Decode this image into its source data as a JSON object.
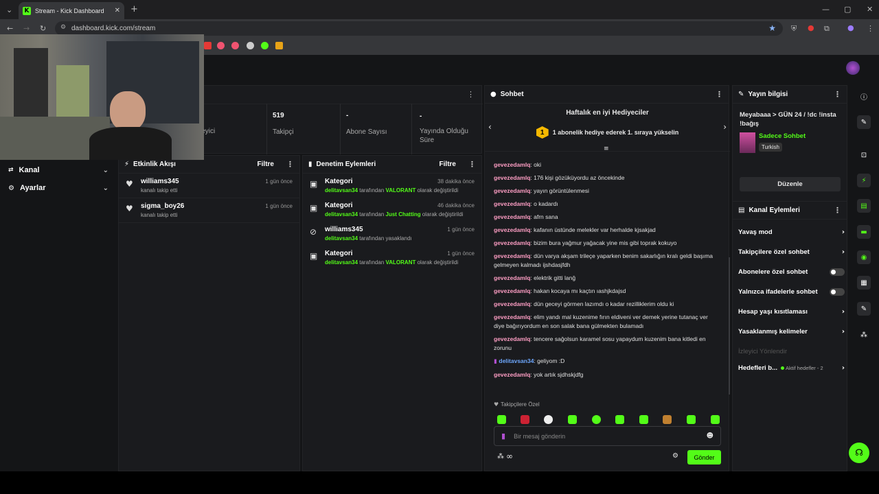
{
  "browser": {
    "tab_title": "Stream - Kick Dashboard",
    "url": "dashboard.kick.com/stream"
  },
  "nav": {
    "items": [
      {
        "label": "Kanal",
        "icon": "channel-icon"
      },
      {
        "label": "Ayarlar",
        "icon": "gear-icon"
      }
    ]
  },
  "stats": {
    "viewers_partial": "leyici",
    "followers_value": "519",
    "followers_label": "Takipçi",
    "subs_value": "-",
    "subs_label": "Abone Sayısı",
    "live_value": "-",
    "live_label": "Yayında Olduğu Süre"
  },
  "activity": {
    "title": "Etkinlik Akışı",
    "filter": "Filtre",
    "events": [
      {
        "user": "williams345",
        "text": "kanalı takip etti",
        "time": "1 gün önce"
      },
      {
        "user": "sigma_boy26",
        "text": "kanalı takip etti",
        "time": "1 gün önce"
      }
    ]
  },
  "moderation": {
    "title": "Denetim Eylemleri",
    "filter": "Filtre",
    "items": [
      {
        "title": "Kategori",
        "time": "38 dakika önce",
        "actor": "delitavsan34",
        "mid": " tarafından ",
        "hl": "VALORANT",
        "end": " olarak değiştirildi"
      },
      {
        "title": "Kategori",
        "time": "46 dakika önce",
        "actor": "delitavsan34",
        "mid": " tarafından ",
        "hl": "Just Chatting",
        "end": " olarak değiştirildi"
      },
      {
        "title": "williams345",
        "time": "1 gün önce",
        "actor": "delitavsan34",
        "mid": " tarafından yasaklandı",
        "hl": "",
        "end": ""
      },
      {
        "title": "Kategori",
        "time": "1 gün önce",
        "actor": "delitavsan34",
        "mid": " tarafından ",
        "hl": "VALORANT",
        "end": " olarak değiştirildi"
      }
    ]
  },
  "chat": {
    "title": "Sohbet",
    "gifters_title": "Haftalık en iyi Hediyeciler",
    "gifters_rank": "1",
    "gifters_text": "1 abonelik hediye ederek 1. sıraya yükselin",
    "messages": [
      {
        "user": "gevezedamlq",
        "text": "oki"
      },
      {
        "user": "gevezedamlq",
        "text": "176 kişi gözüküyordu az öncekinde"
      },
      {
        "user": "gevezedamlq",
        "text": "yayın görüntülenmesi"
      },
      {
        "user": "gevezedamlq",
        "text": "o kadardı"
      },
      {
        "user": "gevezedamlq",
        "text": "afrn sana"
      },
      {
        "user": "gevezedamlq",
        "text": "kafanın üstünde melekler var herhalde kjsakjad"
      },
      {
        "user": "gevezedamlq",
        "text": "bizim bura yağmur yağacak yine mis gibi toprak kokuyo"
      },
      {
        "user": "gevezedamlq",
        "text": "dün varya akşam trileçe yaparken benim sakarlığın kralı geldi başıma gelmeyen kalmadı ijshdasjfdh"
      },
      {
        "user": "gevezedamlq",
        "text": "elektrik gitti lanğ"
      },
      {
        "user": "gevezedamlq",
        "text": "hakan kocaya mı kaçtın ıashjkdajsd"
      },
      {
        "user": "gevezedamlq",
        "text": "dün geceyi görmen lazımdı o kadar rezilliklerim oldu ki"
      },
      {
        "user": "gevezedamlq",
        "text": "elim yandı mal kuzenime fırın eldiveni ver demek yerine tutanaç ver diye bağırıyordum en son salak bana gülmekten bulamadı"
      },
      {
        "user": "gevezedamlq",
        "text": "tencere sağolsun karamel sosu yapaydum kuzenim bana kitledi en zorunu"
      },
      {
        "user": "delitavsan34",
        "text": "geliyom :D",
        "mod": true
      },
      {
        "user": "gevezedamlq",
        "text": "yok artık sjdhskjdfg"
      }
    ],
    "followers_only": "Takipçilere Özel",
    "input_placeholder": "Bir mesaj gönderin",
    "send_label": "Gönder",
    "infinity": "∞"
  },
  "stream_info": {
    "title": "Yayın bilgisi",
    "stream_title": "Meyabaaa > GÜN 24 / !dc !insta !bağış",
    "category": "Sadece Sohbet",
    "language": "Turkish",
    "edit_label": "Düzenle"
  },
  "channel_actions": {
    "title": "Kanal Eylemleri",
    "rows": [
      {
        "label": "Yavaş mod",
        "kind": "chevron"
      },
      {
        "label": "Takipçilere özel sohbet",
        "kind": "chevron"
      },
      {
        "label": "Abonelere özel sohbet",
        "kind": "toggle"
      },
      {
        "label": "Yalnızca ifadelerle sohbet",
        "kind": "toggle"
      },
      {
        "label": "Hesap yaşı kısıtlaması",
        "kind": "chevron"
      },
      {
        "label": "Yasaklanmış kelimeler",
        "kind": "chevron"
      }
    ],
    "redirect_label": "İzleyici Yönlendir",
    "goals_label": "Hedefleri b...",
    "goals_status": "Aktif hedefler - 2"
  },
  "colors": {
    "accent": "#53fc18",
    "panel": "#1a1b1e",
    "chat_user": "#ff9ec4"
  }
}
